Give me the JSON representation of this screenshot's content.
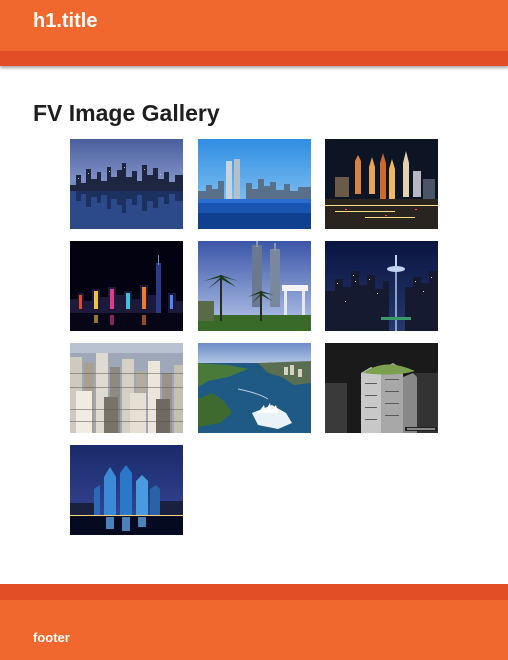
{
  "header": {
    "title": "h1.title"
  },
  "gallery": {
    "heading": "FV Image Gallery",
    "images": [
      {
        "subject": "city skyline reflected in water at dusk"
      },
      {
        "subject": "twin towers skyline over blue water"
      },
      {
        "subject": "casino hotel towers lit at night"
      },
      {
        "subject": "harbour skyline with colorful night lights"
      },
      {
        "subject": "tall towers behind palm trees"
      },
      {
        "subject": "space needle skyline at night"
      },
      {
        "subject": "dense city of high-rise buildings"
      },
      {
        "subject": "aerial view of harbour and opera house"
      },
      {
        "subject": "black and white towers with rooftop garden"
      },
      {
        "subject": "blue-lit skyscrapers over river at night"
      }
    ]
  },
  "footer": {
    "text": "footer"
  },
  "colors": {
    "accent": "#f0682d",
    "accent_dark": "#e24f26",
    "heading": "#1e1e1e",
    "background": "#ffffff"
  }
}
